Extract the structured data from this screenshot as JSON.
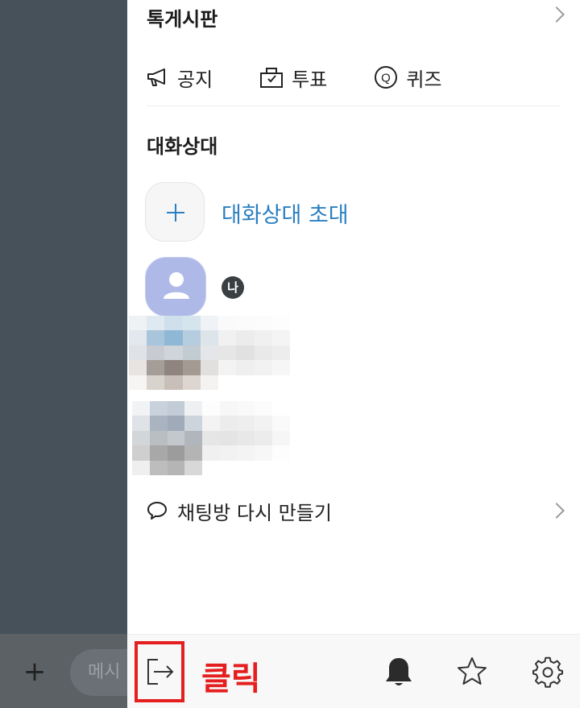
{
  "board": {
    "title": "톡게시판",
    "tools": [
      {
        "label": "공지",
        "icon": "megaphone-icon"
      },
      {
        "label": "투표",
        "icon": "ballot-box-icon"
      },
      {
        "label": "퀴즈",
        "icon": "quiz-icon"
      }
    ]
  },
  "members": {
    "title": "대화상대",
    "invite_label": "대화상대 초대",
    "me_badge": "나",
    "avatar_color": "#aeb9e8"
  },
  "recreate_label": "채팅방 다시 만들기",
  "chat_background": {
    "add_icon": "+",
    "input_placeholder": "메시"
  },
  "bottom_bar": {
    "exit_icon": "exit-icon",
    "annotation_label": "클릭",
    "annotation_color": "#e51f1f",
    "icons": [
      "bell-icon",
      "star-icon",
      "gear-icon"
    ]
  },
  "colors": {
    "accent": "#2b7fc1",
    "backdrop": "#465159"
  }
}
